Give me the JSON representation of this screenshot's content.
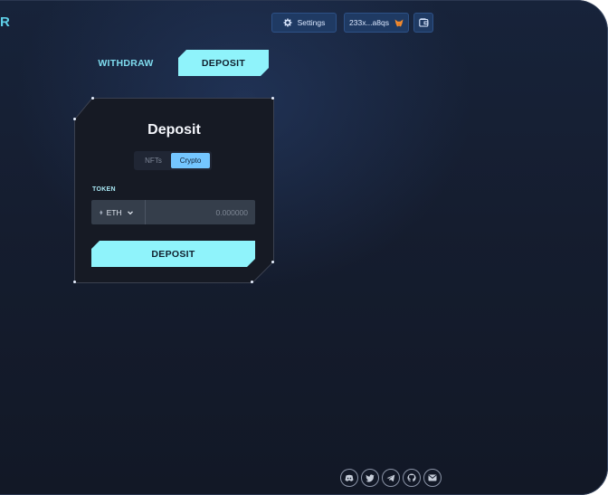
{
  "brand": {
    "text": "R"
  },
  "header": {
    "settings_label": "Settings",
    "wallet_address": "233x...a8qs"
  },
  "tabs": [
    {
      "label": "WITHDRAW",
      "active": false
    },
    {
      "label": "DEPOSIT",
      "active": true
    }
  ],
  "card": {
    "title": "Deposit",
    "segments": [
      {
        "label": "NFTs",
        "active": false
      },
      {
        "label": "Crypto",
        "active": true
      }
    ],
    "token_label": "TOKEN",
    "token_symbol": "ETH",
    "amount_placeholder": "0.000000",
    "submit_label": "DEPOSIT"
  },
  "footer": {
    "socials": [
      "discord-icon",
      "twitter-icon",
      "telegram-icon",
      "github-icon",
      "email-icon"
    ]
  },
  "colors": {
    "accent": "#8ff3fb",
    "accent_text": "#7fdcef",
    "header_button": "#1f3a63",
    "segment_active": "#74c6ff",
    "card_bg": "#161a24",
    "page_bg": "#151d2f"
  }
}
